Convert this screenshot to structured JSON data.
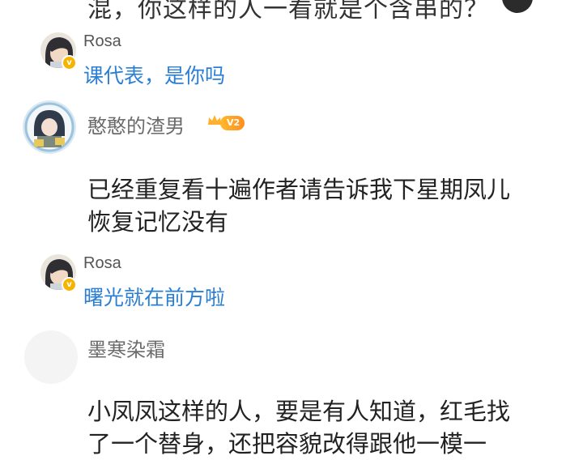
{
  "top_partial": {
    "text": "混，你这样的人一看就是个含串的？"
  },
  "comments": [
    {
      "type": "reply",
      "user": "Rosa",
      "text": "课代表，是你吗"
    },
    {
      "type": "comment",
      "user": "憨憨的渣男",
      "level": "V2",
      "text_line1": "已经重复看十遍作者请告诉我下星期凤儿",
      "text_line2": "恢复记忆没有"
    },
    {
      "type": "reply",
      "user": "Rosa",
      "text": "曙光就在前方啦"
    },
    {
      "type": "comment",
      "user": "墨寒染霜",
      "text_line1": "小凤凤这样的人，要是有人知道，红毛找",
      "text_line2": "了一个替身，还把容貌改得跟他一模一"
    }
  ],
  "colors": {
    "reply_link": "#2a7fd4",
    "username": "#6b6b6b",
    "badge": "#f5b400"
  },
  "icons": [
    "avatar-rosa",
    "verified-v-icon",
    "avatar-hanhan",
    "crown-icon",
    "level-badge",
    "avatar-mohan"
  ]
}
